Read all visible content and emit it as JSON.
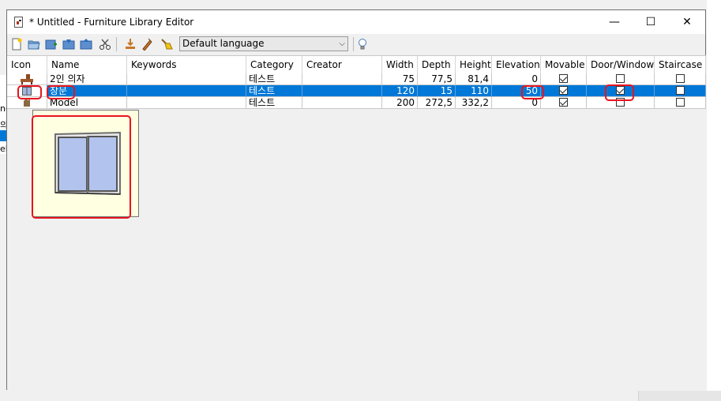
{
  "window": {
    "title": "* Untitled - Furniture Library Editor",
    "controls": {
      "minimize": "—",
      "maximize": "☐",
      "close": "✕"
    }
  },
  "toolbar": {
    "icons": [
      "new-icon",
      "open-icon",
      "add-icon",
      "import-icon",
      "export-icon",
      "cut-icon",
      "download-icon",
      "edit-icon",
      "clean-icon"
    ],
    "language": {
      "selected": "Default language"
    },
    "help_icon": "lightbulb-icon"
  },
  "table": {
    "columns": [
      "Icon",
      "Name",
      "Keywords",
      "Category",
      "Creator",
      "Width",
      "Depth",
      "Height",
      "Elevation",
      "Movable",
      "Door/Window",
      "Staircase"
    ],
    "rows": [
      {
        "name": "2인 의자",
        "keywords": "",
        "category": "테스트",
        "creator": "",
        "width": "75",
        "depth": "77,5",
        "height": "81,4",
        "elevation": "0",
        "movable": true,
        "door_window": false,
        "staircase": false
      },
      {
        "name": "창문",
        "keywords": "",
        "category": "테스트",
        "creator": "",
        "width": "120",
        "depth": "15",
        "height": "110",
        "elevation": "50",
        "movable": true,
        "door_window": true,
        "staircase": false,
        "selected": true
      },
      {
        "name": "Model",
        "keywords": "",
        "category": "테스트",
        "creator": "",
        "width": "200",
        "depth": "272,5",
        "height": "332,2",
        "elevation": "0",
        "movable": true,
        "door_window": false,
        "staircase": false
      }
    ]
  },
  "background_scraps": [
    "ne",
    "의",
    "el"
  ],
  "colors": {
    "selection": "#0078d7",
    "highlight": "#e8141e",
    "tooltip_bg": "#ffffe1"
  }
}
